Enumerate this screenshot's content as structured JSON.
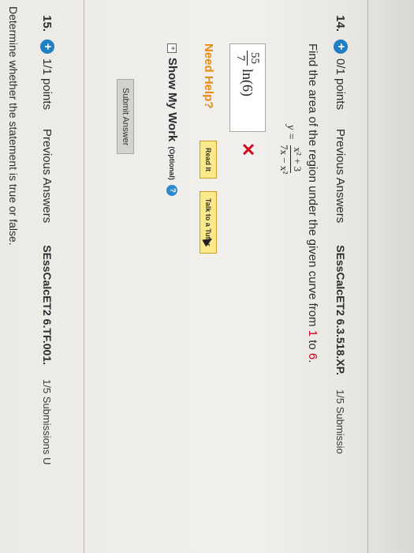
{
  "q14": {
    "number": "14.",
    "points": "0/1 points",
    "previous_answers": "Previous Answers",
    "source": "SEssCalcET2 6.3.518.XP.",
    "submissions": "1/5 Submissio"
  },
  "problem": {
    "text_before": "Find the area of the region under the given curve from ",
    "from": "1",
    "text_mid": " to ",
    "to": "6",
    "text_end": ".",
    "eq_lhs": "y =",
    "eq_num": "x² + 3",
    "eq_den": "7x − x²"
  },
  "answer": {
    "frac_num": "55",
    "frac_den": "7",
    "rest": "ln(6)",
    "mark": "✕"
  },
  "help": {
    "need_help": "Need Help?",
    "read_it": "Read It",
    "talk_tutor": "Talk to a Tutor"
  },
  "show_work": {
    "toggle": "+",
    "label": "Show My Work",
    "optional": "(Optional)",
    "help_icon": "?"
  },
  "submit": {
    "label": "Submit Answer"
  },
  "q15": {
    "number": "15.",
    "points": "1/1 points",
    "previous_answers": "Previous Answers",
    "source": "SEssCalcET2 6.TF.001.",
    "submissions": "1/5 Submissions U",
    "prompt": "Determine whether the statement is true or false."
  },
  "colors": {
    "accent_blue": "#1f7fc2",
    "need_help_orange": "#e58a12",
    "error_red": "#d0021b",
    "help_yellow": "#fce98a"
  }
}
